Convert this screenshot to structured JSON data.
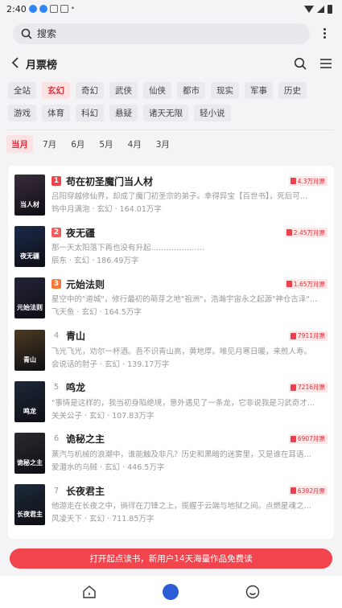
{
  "status_bar": {
    "time": "2:40"
  },
  "search": {
    "placeholder": "搜索"
  },
  "header": {
    "title": "月票榜"
  },
  "categories": [
    "全站",
    "玄幻",
    "奇幻",
    "武侠",
    "仙侠",
    "都市",
    "现实",
    "军事",
    "历史",
    "游戏",
    "体育",
    "科幻",
    "悬疑",
    "诸天无限",
    "轻小说"
  ],
  "active_category": "玄幻",
  "months": [
    "当月",
    "7月",
    "6月",
    "5月",
    "4月",
    "3月"
  ],
  "active_month": "当月",
  "books": [
    {
      "rank": "1",
      "title": "苟在初圣魔门当人材",
      "tickets": "4.3万月票",
      "desc": "吕阳穿越修仙界，却成了魔门初圣宗的弟子。幸得异宝【百世书】，死后可…",
      "meta": "钨中月满泡 · 玄幻 · 164.01万字",
      "cover_text": "当人材",
      "cover_color": "#3a2c3c"
    },
    {
      "rank": "2",
      "title": "夜无疆",
      "tickets": "2.45万月票",
      "desc": "那一天太阳落下再也没有升起…………………",
      "meta": "辰东 · 玄幻 · 186.49万字",
      "cover_text": "夜无疆",
      "cover_color": "#1b2a4a"
    },
    {
      "rank": "3",
      "title": "元始法则",
      "tickets": "1.65万月票",
      "desc": "星空中的\"道城\"，修行最初的萌芽之地\"祖洲\"，浩瀚宇宙永之起源\"神仓古泽\"…",
      "meta": "飞天鱼 · 玄幻 · 164.5万字",
      "cover_text": "元始法则",
      "cover_color": "#24243a"
    },
    {
      "rank": "4",
      "title": "青山",
      "tickets": "7911月票",
      "desc": "飞光飞光，劝尔一杯酒。吾不识青山高，黄地厚。唯见月寒日暖，来煎人寿。",
      "meta": "会说话的肘子 · 玄幻 · 139.17万字",
      "cover_text": "青山",
      "cover_color": "#4a3a22"
    },
    {
      "rank": "5",
      "title": "鸣龙",
      "tickets": "7216月票",
      "desc": "\"事情是这样的，我当初身陷绝境，意外遇见了一条龙，它非说我是习武奇才…",
      "meta": "关关公子 · 玄幻 · 107.83万字",
      "cover_text": "鸣龙",
      "cover_color": "#1e2838"
    },
    {
      "rank": "6",
      "title": "诡秘之主",
      "tickets": "6907月票",
      "desc": "蒸汽与机械的浪潮中，谁能触及非凡？历史和黑暗的迷雾里，又是谁在耳语…",
      "meta": "爱潜水的乌贼 · 玄幻 · 446.5万字",
      "cover_text": "诡秘之主",
      "cover_color": "#2a2a2e"
    },
    {
      "rank": "7",
      "title": "长夜君主",
      "tickets": "6392月票",
      "desc": "他游走在长夜之中，徜徉在刀锋之上，揽握于云端与地狱之间。点燃星魂之…",
      "meta": "风凌天下 · 玄幻 · 711.85万字",
      "cover_text": "长夜君主",
      "cover_color": "#1e2a3a"
    }
  ],
  "cta": {
    "label": "打开起点读书，新用户14天海量作品免费读"
  },
  "colors": {
    "accent": "#e0303c",
    "rank1": "#f0424c",
    "rank2": "#f45c5c",
    "rank3": "#f5793a",
    "cta": "#f2444c",
    "nav_active": "#2c5bd6"
  }
}
